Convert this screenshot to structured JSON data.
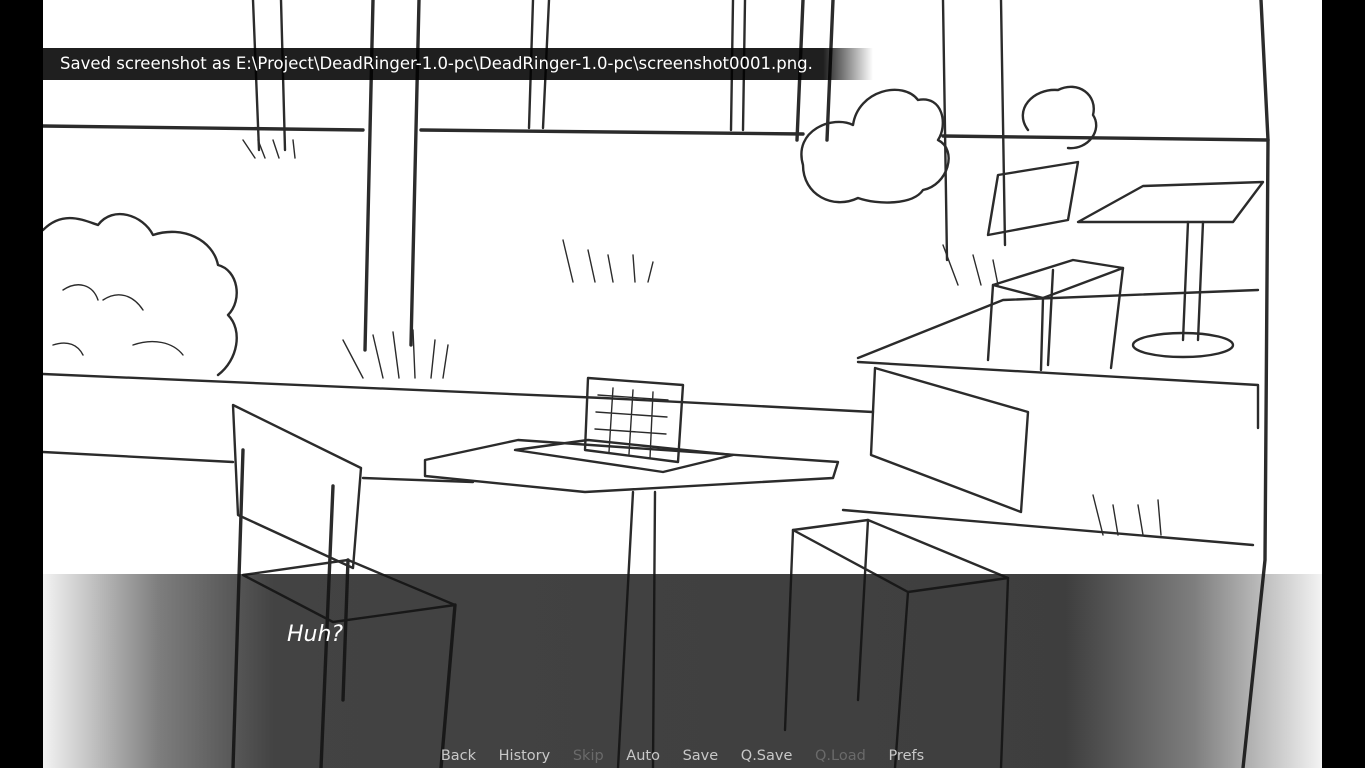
{
  "notification": {
    "text": "Saved screenshot as E:\\Project\\DeadRinger-1.0-pc\\DeadRinger-1.0-pc\\screenshot0001.png."
  },
  "dialogue": {
    "text": "Huh?"
  },
  "quick_menu": {
    "back": "Back",
    "history": "History",
    "skip": "Skip",
    "auto": "Auto",
    "save": "Save",
    "qsave": "Q.Save",
    "qload": "Q.Load",
    "prefs": "Prefs"
  },
  "colors": {
    "letterbox": "#000000",
    "menu_enabled": "#c8c8c8",
    "menu_disabled": "#6a6a6a"
  }
}
